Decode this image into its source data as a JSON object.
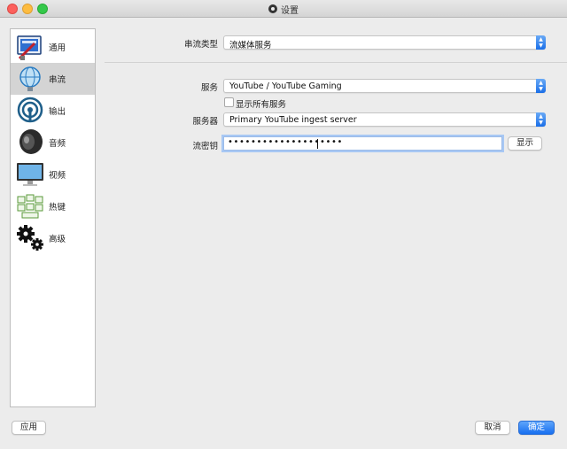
{
  "window": {
    "title": "设置"
  },
  "sidebar": {
    "items": [
      {
        "label": "通用",
        "icon": "general-settings-icon"
      },
      {
        "label": "串流",
        "icon": "stream-globe-icon",
        "selected": true
      },
      {
        "label": "输出",
        "icon": "output-broadcast-icon"
      },
      {
        "label": "音频",
        "icon": "speaker-icon"
      },
      {
        "label": "视频",
        "icon": "monitor-icon"
      },
      {
        "label": "热键",
        "icon": "keyboard-icon"
      },
      {
        "label": "高级",
        "icon": "gears-icon"
      }
    ]
  },
  "stream": {
    "type_label": "串流类型",
    "type_value": "流媒体服务",
    "service_label": "服务",
    "service_value": "YouTube / YouTube Gaming",
    "show_all_label": "显示所有服务",
    "show_all_checked": false,
    "server_label": "服务器",
    "server_value": "Primary YouTube ingest server",
    "key_label": "流密钥",
    "key_value": "••••••••••••••••••••",
    "show_key_button": "显示"
  },
  "footer": {
    "apply": "应用",
    "cancel": "取消",
    "ok": "确定"
  },
  "colors": {
    "accent": "#1a6ee8",
    "selected_bg": "#d4d4d4",
    "window_bg": "#ececec"
  }
}
